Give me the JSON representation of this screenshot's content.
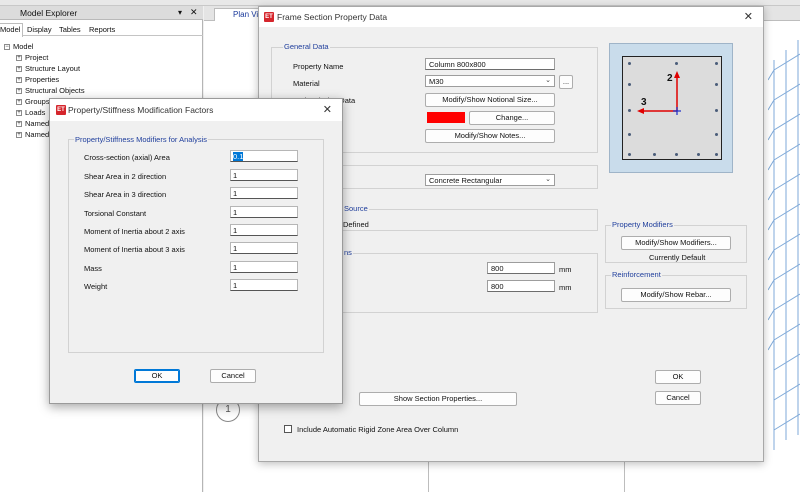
{
  "explorer": {
    "title": "Model Explorer",
    "pin_glyph": "▾",
    "close_glyph": "✕",
    "tabs": [
      "Model",
      "Display",
      "Tables",
      "Reports"
    ],
    "tree": [
      {
        "label": "Model",
        "sign": "−"
      },
      {
        "label": "Project",
        "sign": "+"
      },
      {
        "label": "Structure Layout",
        "sign": "+"
      },
      {
        "label": "Properties",
        "sign": "+"
      },
      {
        "label": "Structural Objects",
        "sign": "+"
      },
      {
        "label": "Groups",
        "sign": "+"
      },
      {
        "label": "Loads",
        "sign": "+"
      },
      {
        "label": "Named",
        "sign": "+"
      },
      {
        "label": "Named",
        "sign": "+"
      }
    ]
  },
  "planview": {
    "tab_label": "Plan Vi",
    "bubble": "1"
  },
  "frame_dialog": {
    "title": "Frame Section Property Data",
    "icon": "ET",
    "close": "✕",
    "general": {
      "label": "General Data",
      "property_name_label": "Property Name",
      "property_name_value": "Column 800x800",
      "material_label": "Material",
      "material_value": "M30",
      "ellipsis": "...",
      "notional_label": "Notional Size Data",
      "notional_button": "Modify/Show Notional Size...",
      "color_value": "#ff0000",
      "change_button": "Change...",
      "notes_button": "Modify/Show Notes..."
    },
    "shape_value": "Concrete Rectangular",
    "source_label": "Source",
    "source_value": "Defined",
    "dims_label": "ns",
    "depth_value": "800",
    "width_value": "800",
    "unit": "mm",
    "show_section_button": "Show Section Properties...",
    "rigid_zone_label": "Include Automatic Rigid Zone Area Over Column",
    "property_modifiers": {
      "label": "Property Modifiers",
      "button": "Modify/Show Modifiers...",
      "status": "Currently Default"
    },
    "reinforcement": {
      "label": "Reinforcement",
      "button": "Modify/Show Rebar..."
    },
    "ok": "OK",
    "cancel": "Cancel",
    "axis2": "2",
    "axis3": "3"
  },
  "modifier_dialog": {
    "title": "Property/Stiffness Modification Factors",
    "icon": "ET",
    "close": "✕",
    "group_label": "Property/Stiffness Modifiers for Analysis",
    "rows": [
      {
        "label": "Cross-section (axial) Area",
        "value": "0.1"
      },
      {
        "label": "Shear Area in 2 direction",
        "value": "1"
      },
      {
        "label": "Shear Area in 3 direction",
        "value": "1"
      },
      {
        "label": "Torsional Constant",
        "value": "1"
      },
      {
        "label": "Moment of Inertia about 2 axis",
        "value": "1"
      },
      {
        "label": "Moment of Inertia about 3 axis",
        "value": "1"
      },
      {
        "label": "Mass",
        "value": "1"
      },
      {
        "label": "Weight",
        "value": "1"
      }
    ],
    "ok": "OK",
    "cancel": "Cancel"
  }
}
